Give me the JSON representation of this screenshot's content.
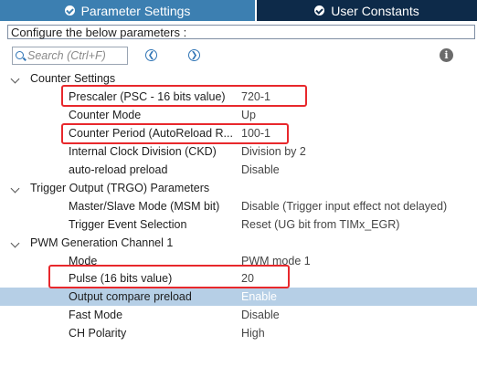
{
  "tabs": [
    {
      "label": "Parameter Settings",
      "active": true
    },
    {
      "label": "User Constants",
      "active": false
    }
  ],
  "config_header": "Configure the below parameters :",
  "search": {
    "placeholder": "Search (Ctrl+F)",
    "value": ""
  },
  "icons": {
    "prev": "chevron-left-circle-icon",
    "next": "chevron-right-circle-icon",
    "info": "info-icon"
  },
  "colors": {
    "active_tab": "#3c7fb1",
    "inactive_tab": "#0d2a49",
    "selection": "#b6cfe6",
    "highlight": "#e8282c"
  },
  "groups": [
    {
      "label": "Counter Settings",
      "params": [
        {
          "label": "Prescaler (PSC - 16 bits value)",
          "value": "720-1"
        },
        {
          "label": "Counter Mode",
          "value": "Up"
        },
        {
          "label": "Counter Period (AutoReload R...",
          "value": "100-1"
        },
        {
          "label": "Internal Clock Division (CKD)",
          "value": "Division by 2"
        },
        {
          "label": "auto-reload preload",
          "value": "Disable"
        }
      ]
    },
    {
      "label": "Trigger Output (TRGO) Parameters",
      "params": [
        {
          "label": "Master/Slave Mode (MSM bit)",
          "value": "Disable (Trigger input effect not delayed)"
        },
        {
          "label": "Trigger Event Selection",
          "value": "Reset (UG bit from TIMx_EGR)"
        }
      ]
    },
    {
      "label": "PWM Generation Channel 1",
      "params": [
        {
          "label": "Mode",
          "value": "PWM mode 1"
        },
        {
          "label": "Pulse (16 bits value)",
          "value": "20"
        },
        {
          "label": "Output compare preload",
          "value": "Enable",
          "selected": true
        },
        {
          "label": "Fast Mode",
          "value": "Disable"
        },
        {
          "label": "CH Polarity",
          "value": "High"
        }
      ]
    }
  ]
}
